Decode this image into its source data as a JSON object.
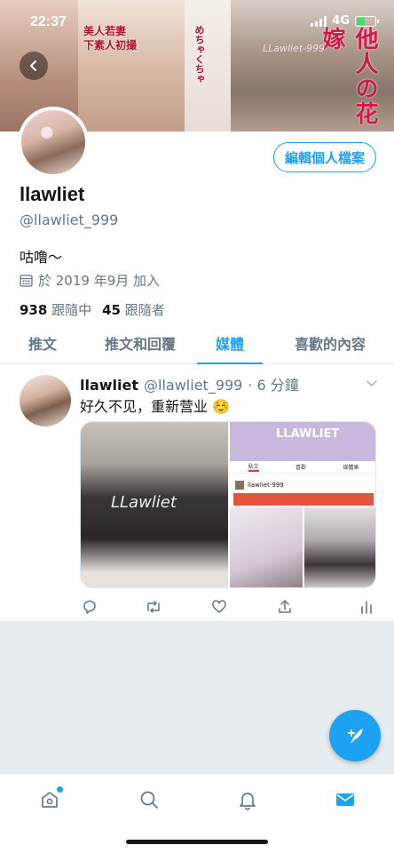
{
  "status_bar": {
    "time": "22:37",
    "network": "4G"
  },
  "banner": {
    "text_a": "美人若妻",
    "text_b": "下素人初撮",
    "text_c": "他人の花嫁",
    "text_d": "めちゃくちゃ",
    "watermark": "LLawliet-999"
  },
  "profile": {
    "edit_label": "編輯個人檔案",
    "name": "llawliet",
    "handle": "@llawliet_999",
    "bio": "咕噜～",
    "joined": "於 2019 年9月 加入",
    "following_count": "938",
    "following_label": "跟隨中",
    "followers_count": "45",
    "followers_label": "跟隨者"
  },
  "tabs": [
    {
      "label": "推文"
    },
    {
      "label": "推文和回覆"
    },
    {
      "label": "媒體"
    },
    {
      "label": "喜歡的內容"
    }
  ],
  "active_tab": 2,
  "tweet": {
    "name": "llawliet",
    "handle": "@llawliet_999",
    "time": "· 6 分鐘",
    "text": "好久不见，重新营业 ☺️",
    "media_watermark": "LLawliet",
    "inner_title": "LLAWLIET",
    "inner_tab_1": "貼文",
    "inner_tab_2": "喜歡",
    "inner_tab_3": "媒體庫",
    "inner_user": "llawliet-999"
  },
  "colors": {
    "accent": "#1da1f2",
    "text": "#14171a",
    "muted": "#657786",
    "divider": "#e1e8ed",
    "background_gray": "#e6ecf0"
  },
  "icons": [
    "back-arrow-icon",
    "calendar-icon",
    "chevron-down-icon",
    "reply-icon",
    "retweet-icon",
    "like-icon",
    "share-icon",
    "analytics-icon",
    "compose-tweet-icon",
    "home-icon",
    "search-icon",
    "notifications-icon",
    "messages-icon"
  ]
}
